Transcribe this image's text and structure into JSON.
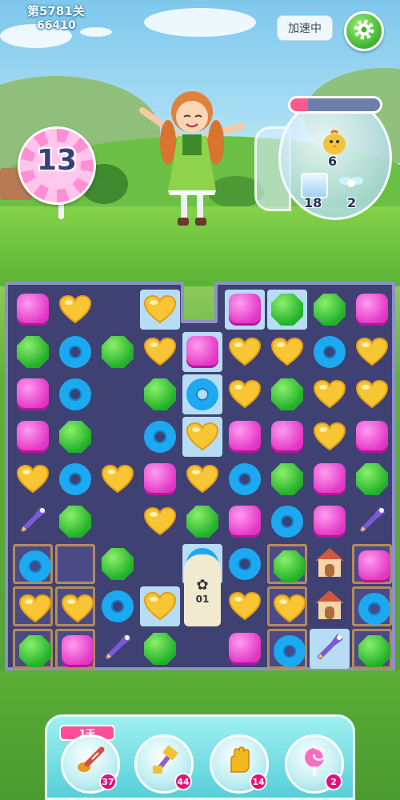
{
  "header": {
    "level_label": "第5781关",
    "score": "66410",
    "speed_label": "加速中",
    "settings_icon": "gear-icon"
  },
  "moves_left": "13",
  "goals": [
    {
      "item": "chick",
      "count": "6"
    },
    {
      "item": "ice-block",
      "count": "18"
    },
    {
      "item": "fairy",
      "count": "2"
    }
  ],
  "goal_progress": 0.2,
  "board": {
    "rows": [
      [
        "pink",
        "heart",
        "void",
        "heart",
        "pink",
        "green",
        "green",
        "pink"
      ],
      [
        "green",
        "donut",
        "green",
        "heart",
        "pink",
        "heart",
        "heart",
        "donut",
        "heart"
      ],
      [
        "pink",
        "donut",
        "",
        "green",
        "donut",
        "heart",
        "green",
        "heart",
        "heart"
      ],
      [
        "pink",
        "green",
        "",
        "donut",
        "heart",
        "pink",
        "pink",
        "heart",
        "pink"
      ],
      [
        "heart",
        "donut",
        "heart",
        "pink",
        "heart",
        "donut",
        "green",
        "pink",
        "green"
      ],
      [
        "rocket",
        "green",
        "",
        "heart",
        "green",
        "pink",
        "donut",
        "pink",
        "rocket"
      ],
      [
        "donut",
        "",
        "green",
        "",
        "donut",
        "donut",
        "green",
        "house",
        "pink"
      ],
      [
        "heart",
        "heart",
        "donut",
        "heart",
        "tower",
        "heart",
        "heart",
        "house",
        "donut"
      ],
      [
        "green",
        "pink",
        "rocket",
        "green",
        "",
        "pink",
        "donut",
        "rocket",
        "green"
      ]
    ],
    "tower_label": "01"
  },
  "boosters": {
    "day_label": "1天",
    "items": [
      {
        "name": "spoon-booster",
        "count": "37"
      },
      {
        "name": "hammer-booster",
        "count": "44"
      },
      {
        "name": "glove-booster",
        "count": "14"
      },
      {
        "name": "lollipop-booster",
        "count": "2"
      }
    ]
  },
  "colors": {
    "board_bg": "#3f4173",
    "accent_pink": "#e235c4",
    "booster_count": "#e2127a"
  }
}
